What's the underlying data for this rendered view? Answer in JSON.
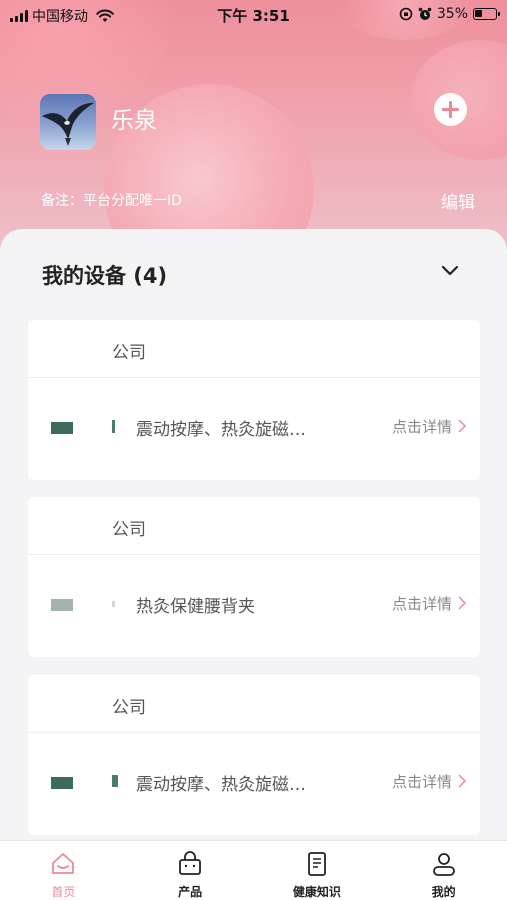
{
  "status_bar": {
    "carrier": "中国移动",
    "time": "下午 3:51",
    "battery": "35%"
  },
  "profile": {
    "name": "乐泉",
    "remark": "备注：平台分配唯一ID",
    "edit_label": "编辑",
    "avatar_icon": "eagle-photo"
  },
  "devices": {
    "title": "我的设备 (4)",
    "items": [
      {
        "group": "公司",
        "name": "震动按摩、热灸旋磁…",
        "detail": "点击详情"
      },
      {
        "group": "公司",
        "name": "热灸保健腰背夹",
        "detail": "点击详情"
      },
      {
        "group": "公司",
        "name": "震动按摩、热灸旋磁…",
        "detail": "点击详情"
      }
    ]
  },
  "tabs": [
    {
      "label": "首页",
      "icon": "home-icon",
      "active": true
    },
    {
      "label": "产品",
      "icon": "bag-icon",
      "active": false
    },
    {
      "label": "健康知识",
      "icon": "book-icon",
      "active": false
    },
    {
      "label": "我的",
      "icon": "user-icon",
      "active": false
    }
  ],
  "colors": {
    "accent": "#ef8896",
    "header_pink": "#ee8f9c",
    "device_green": "#3d6b5c"
  }
}
